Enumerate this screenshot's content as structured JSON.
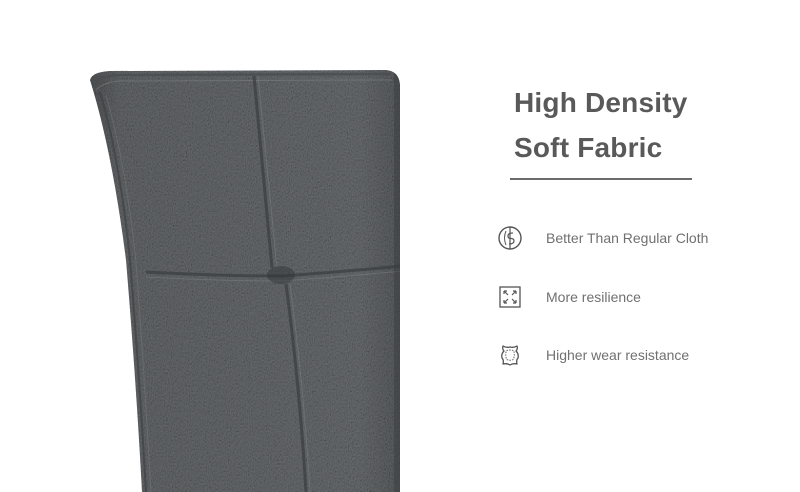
{
  "headline": {
    "line1": "High Density",
    "line2": "Soft Fabric"
  },
  "features": [
    {
      "icon": "cloth-circle-icon",
      "label": "Better Than Regular Cloth"
    },
    {
      "icon": "expand-arrows-icon",
      "label": "More resilience"
    },
    {
      "icon": "leather-hide-icon",
      "label": "Higher wear resistance"
    }
  ],
  "colors": {
    "fabric": "#5a5d60",
    "fabric_light": "#6b6e71",
    "fabric_dark": "#3f4245",
    "text": "#595959",
    "subtext": "#707070"
  }
}
